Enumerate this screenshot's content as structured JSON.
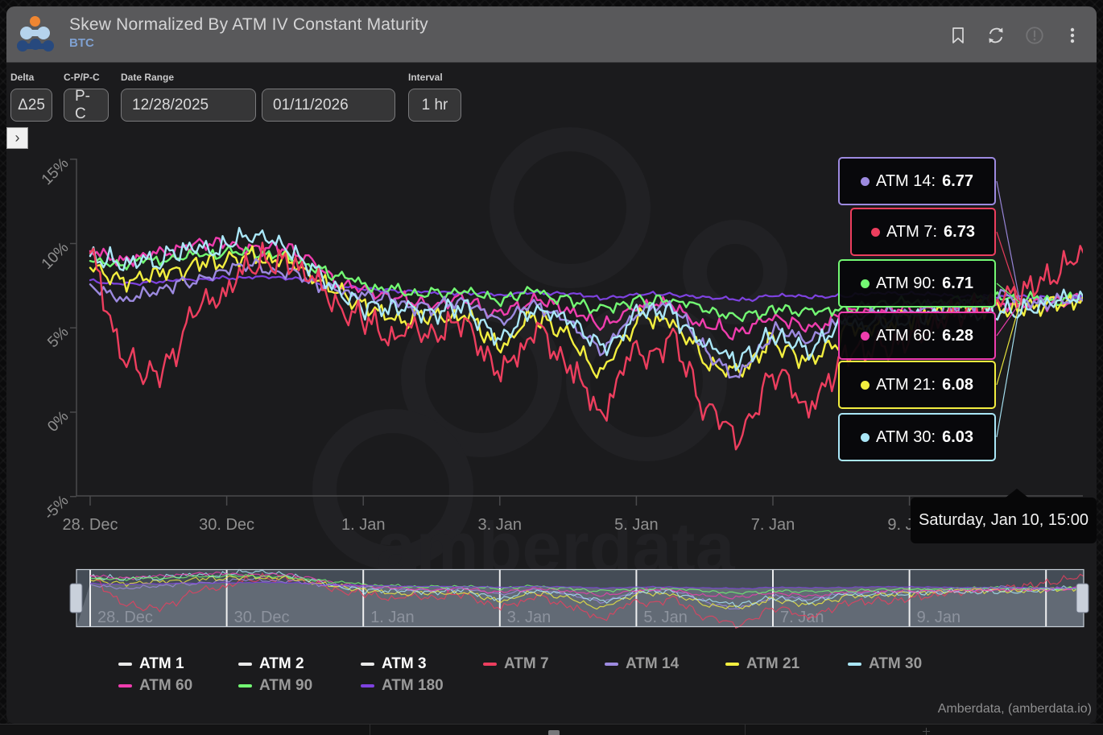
{
  "header": {
    "title": "Skew Normalized By ATM IV Constant Maturity",
    "subtitle": "BTC",
    "icons": [
      "bookmark-icon",
      "refresh-icon",
      "alert-icon",
      "kebab-menu-icon"
    ]
  },
  "controls": {
    "delta": {
      "label": "Delta",
      "value": "Δ25"
    },
    "cp_pc": {
      "label": "C-P/P-C",
      "value": "P-C"
    },
    "date_range": {
      "label": "Date Range",
      "start": "12/28/2025",
      "end": "01/11/2026"
    },
    "interval": {
      "label": "Interval",
      "value": "1 hr"
    }
  },
  "expander": {
    "glyph": "›"
  },
  "chart_data": {
    "type": "line",
    "title": "Skew Normalized By ATM IV Constant Maturity",
    "x_start": "2025-12-28 00:00",
    "x_step_days": 0.5,
    "x_tick_labels": [
      "28. Dec",
      "30. Dec",
      "1. Jan",
      "3. Jan",
      "5. Jan",
      "7. Jan",
      "9. Jan"
    ],
    "navigator_tick_labels": [
      "28. Dec",
      "30. Dec",
      "1. Jan",
      "3. Jan",
      "5. Jan",
      "7. Jan",
      "9. Jan"
    ],
    "y_ticks": [
      {
        "label": "15%",
        "value": 15
      },
      {
        "label": "10%",
        "value": 10
      },
      {
        "label": "5%",
        "value": 5
      },
      {
        "label": "0%",
        "value": 0
      },
      {
        "label": "-5%",
        "value": -5
      }
    ],
    "ylim": [
      -5,
      15
    ],
    "grid": false,
    "legend_position": "bottom",
    "series": [
      {
        "name": "ATM 7",
        "color": "#ed3e5e",
        "visible": true,
        "values": [
          9.2,
          3.0,
          2.3,
          5.5,
          7.6,
          9.0,
          8.8,
          7.0,
          5.4,
          5.0,
          4.4,
          5.2,
          2.0,
          4.8,
          3.2,
          -0.4,
          3.8,
          4.2,
          0.6,
          -1.2,
          2.2,
          0.6,
          3.2,
          3.8,
          4.4,
          5.6,
          6.2,
          6.73,
          8.2,
          9.4
        ]
      },
      {
        "name": "ATM 14",
        "color": "#9d8ae0",
        "visible": true,
        "values": [
          7.4,
          6.8,
          7.2,
          7.8,
          8.3,
          8.5,
          8.2,
          7.2,
          6.8,
          6.6,
          6.3,
          6.6,
          5.2,
          6.2,
          5.6,
          3.6,
          6.0,
          6.2,
          3.9,
          1.9,
          5.0,
          4.1,
          5.5,
          5.8,
          6.0,
          6.2,
          6.5,
          6.77,
          6.7,
          6.6
        ]
      },
      {
        "name": "ATM 21",
        "color": "#f2ee3f",
        "visible": true,
        "values": [
          8.4,
          7.8,
          8.1,
          8.7,
          9.0,
          9.1,
          8.7,
          7.0,
          6.1,
          5.8,
          5.5,
          5.9,
          3.8,
          5.6,
          4.8,
          2.3,
          5.2,
          5.4,
          2.9,
          2.1,
          4.2,
          3.1,
          4.8,
          5.2,
          5.5,
          5.8,
          6.0,
          6.08,
          6.4,
          6.7
        ]
      },
      {
        "name": "ATM 30",
        "color": "#aae7f8",
        "visible": true,
        "values": [
          9.4,
          8.8,
          9.2,
          9.8,
          10.2,
          10.4,
          9.6,
          7.4,
          6.4,
          6.1,
          6.0,
          6.3,
          4.6,
          6.0,
          5.3,
          3.6,
          5.7,
          5.9,
          4.1,
          3.1,
          4.8,
          3.9,
          5.2,
          5.4,
          5.6,
          5.8,
          6.0,
          6.03,
          6.3,
          6.5
        ]
      },
      {
        "name": "ATM 60",
        "color": "#ef3dae",
        "visible": true,
        "values": [
          9.6,
          9.2,
          9.4,
          9.8,
          10.0,
          9.8,
          9.4,
          8.0,
          7.1,
          6.8,
          6.5,
          6.8,
          5.8,
          6.5,
          6.0,
          5.0,
          6.2,
          6.3,
          5.2,
          4.6,
          5.6,
          5.1,
          5.8,
          6.0,
          6.1,
          6.2,
          6.25,
          6.28,
          6.5,
          6.7
        ]
      },
      {
        "name": "ATM 90",
        "color": "#73f873",
        "visible": true,
        "values": [
          9.1,
          8.8,
          9.0,
          9.3,
          9.5,
          9.4,
          9.1,
          8.2,
          7.5,
          7.2,
          7.0,
          7.1,
          6.5,
          7.0,
          6.6,
          6.0,
          6.6,
          6.7,
          6.0,
          5.6,
          6.2,
          5.9,
          6.3,
          6.4,
          6.5,
          6.6,
          6.65,
          6.71,
          6.8,
          6.9
        ]
      },
      {
        "name": "ATM 180",
        "color": "#7e42e0",
        "visible": true,
        "values": [
          7.8,
          7.6,
          7.7,
          7.9,
          8.0,
          8.0,
          7.9,
          7.5,
          7.3,
          7.2,
          7.1,
          7.1,
          6.9,
          7.1,
          7.0,
          6.7,
          7.0,
          7.0,
          6.8,
          6.6,
          6.9,
          6.8,
          6.9,
          7.0,
          7.0,
          6.95,
          6.9,
          6.85,
          6.8,
          6.75
        ]
      }
    ],
    "hidden_series": [
      {
        "name": "ATM 1",
        "legend_color": "#e9e9e9"
      },
      {
        "name": "ATM 2",
        "legend_color": "#e9e9e9"
      },
      {
        "name": "ATM 3",
        "legend_color": "#e9e9e9"
      }
    ]
  },
  "tooltip": {
    "date_label": "Saturday, Jan 10, 15:00",
    "hover_time": "Jan 10, 15:00",
    "items": [
      {
        "series": "ATM 14",
        "value": "6.77",
        "color": "#9d8ae0"
      },
      {
        "series": "ATM 7",
        "value": "6.73",
        "color": "#ed3e5e"
      },
      {
        "series": "ATM 90",
        "value": "6.71",
        "color": "#73f873"
      },
      {
        "series": "ATM 60",
        "value": "6.28",
        "color": "#ef3dae"
      },
      {
        "series": "ATM 21",
        "value": "6.08",
        "color": "#f2ee3f"
      },
      {
        "series": "ATM 30",
        "value": "6.03",
        "color": "#aae7f8"
      }
    ]
  },
  "legend": {
    "items": [
      {
        "label": "ATM 1",
        "color": "#e9e9e9",
        "hidden": true
      },
      {
        "label": "ATM 2",
        "color": "#e9e9e9",
        "hidden": true
      },
      {
        "label": "ATM 3",
        "color": "#e9e9e9",
        "hidden": true
      },
      {
        "label": "ATM 7",
        "color": "#ed3e5e",
        "hidden": false
      },
      {
        "label": "ATM 14",
        "color": "#9d8ae0",
        "hidden": false
      },
      {
        "label": "ATM 21",
        "color": "#f2ee3f",
        "hidden": false
      },
      {
        "label": "ATM 30",
        "color": "#aae7f8",
        "hidden": false
      },
      {
        "label": "ATM 60",
        "color": "#ef3dae",
        "hidden": false
      },
      {
        "label": "ATM 90",
        "color": "#73f873",
        "hidden": false
      },
      {
        "label": "ATM 180",
        "color": "#7e42e0",
        "hidden": false
      }
    ]
  },
  "watermark": {
    "text": "amberdata"
  },
  "attribution": "Amberdata, (amberdata.io)"
}
